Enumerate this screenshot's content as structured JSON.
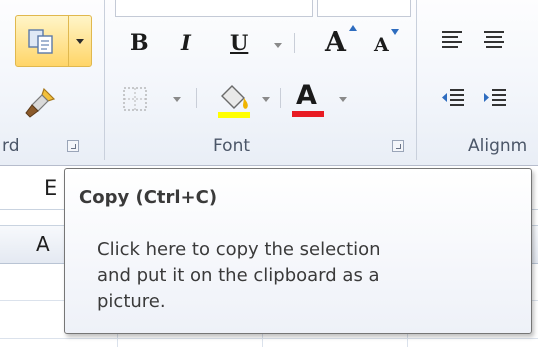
{
  "ribbon": {
    "groups": {
      "clipboard": {
        "label": "rd"
      },
      "font": {
        "label": "Font",
        "bold_label": "B",
        "italic_label": "I",
        "underline_label": "U",
        "grow_font_label": "A",
        "shrink_font_label": "A",
        "font_color_label": "A"
      },
      "alignment": {
        "label": "Alignm"
      }
    }
  },
  "name_box": {
    "value": "E"
  },
  "grid": {
    "column_headers": [
      "A"
    ]
  },
  "tooltip": {
    "title": "Copy (Ctrl+C)",
    "body_lines": [
      "Click here to copy the selection",
      "and put it on the clipboard as a",
      "picture."
    ]
  },
  "colors": {
    "highlight_bar": "#ffff00",
    "font_color_bar": "#e81b23",
    "hover_fill": "#ffd568",
    "hover_border": "#e0b84e"
  }
}
